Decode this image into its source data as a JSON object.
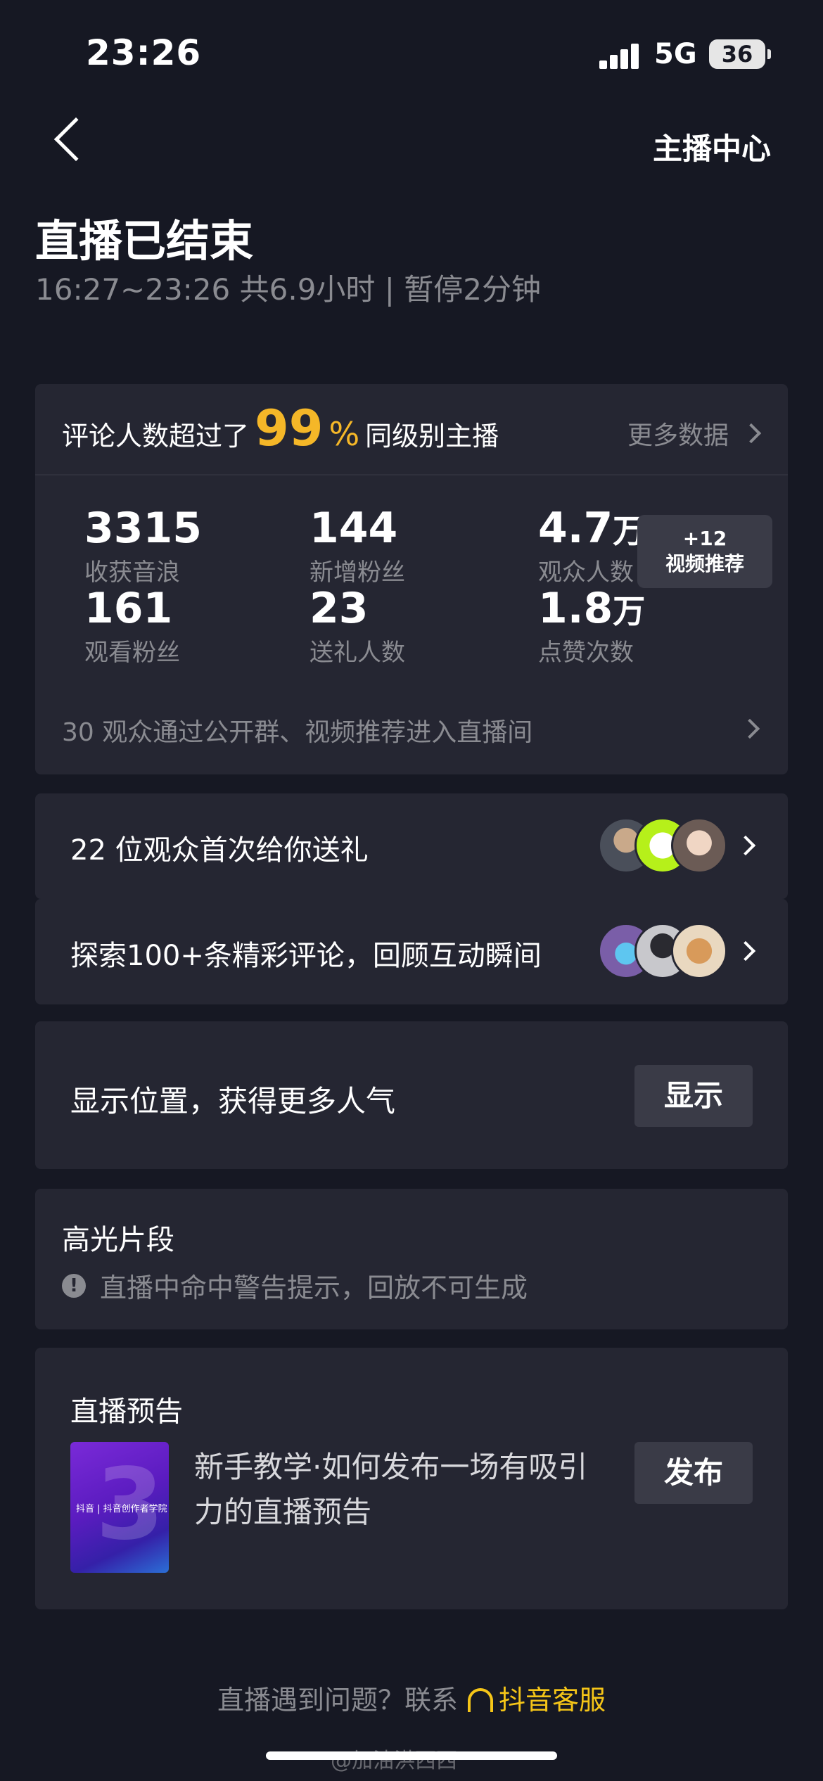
{
  "status_bar": {
    "time": "23:26",
    "network": "5G",
    "battery": "36"
  },
  "nav": {
    "back_icon": "chevron-left-icon",
    "right_link": "主播中心"
  },
  "header": {
    "title": "直播已结束",
    "subtitle": "16:27~23:26 共6.9小时 | 暂停2分钟"
  },
  "stats_card": {
    "prefix": "评论人数超过了",
    "percent": "99",
    "percent_sign": "%",
    "suffix": "同级别主播",
    "more_label": "更多数据",
    "stats": [
      {
        "value": "3315",
        "unit": "",
        "label": "收获音浪"
      },
      {
        "value": "144",
        "unit": "",
        "label": "新增粉丝"
      },
      {
        "value": "4.7",
        "unit": "万",
        "label": "观众人数"
      },
      {
        "value": "161",
        "unit": "",
        "label": "观看粉丝"
      },
      {
        "value": "23",
        "unit": "",
        "label": "送礼人数"
      },
      {
        "value": "1.8",
        "unit": "万",
        "label": "点赞次数"
      }
    ],
    "badge_count": "+12",
    "badge_label": "视频推荐",
    "entry_line": "30 观众通过公开群、视频推荐进入直播间"
  },
  "gift_row": {
    "text": "22 位观众首次给你送礼"
  },
  "comment_row": {
    "text": "探索100+条精彩评论，回顾互动瞬间"
  },
  "location_card": {
    "text": "显示位置，获得更多人气",
    "button": "显示"
  },
  "highlight_card": {
    "title": "高光片段",
    "warning": "直播中命中警告提示，回放不可生成"
  },
  "preview_card": {
    "title": "直播预告",
    "thumb_text": "抖音 | 抖音创作者学院",
    "description": "新手教学·如何发布一场有吸引力的直播预告",
    "button": "发布"
  },
  "footer": {
    "prefix": "直播遇到问题？联系",
    "link": "抖音客服"
  },
  "watermark": "@加油洪西西",
  "colors": {
    "background": "#161823",
    "card": "#252632",
    "accent": "#f5b728",
    "muted": "#8a8b91"
  }
}
